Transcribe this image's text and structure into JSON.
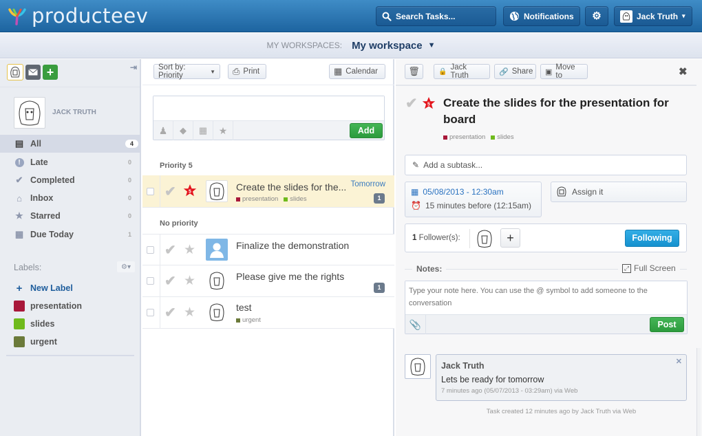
{
  "header": {
    "app_name": "producteev",
    "search_label": "Search Tasks...",
    "notifications_label": "Notifications",
    "user_label": "Jack Truth"
  },
  "workspace": {
    "label": "MY WORKSPACES:",
    "current": "My workspace"
  },
  "sidebar": {
    "profile_name": "JACK TRUTH",
    "nav": [
      {
        "label": "All",
        "count": "4",
        "icon": "all-tasks-icon"
      },
      {
        "label": "Late",
        "count": "0",
        "icon": "late-icon"
      },
      {
        "label": "Completed",
        "count": "0",
        "icon": "check-icon"
      },
      {
        "label": "Inbox",
        "count": "0",
        "icon": "inbox-icon"
      },
      {
        "label": "Starred",
        "count": "0",
        "icon": "star-icon"
      },
      {
        "label": "Due Today",
        "count": "1",
        "icon": "calendar-icon"
      }
    ],
    "labels_title": "Labels:",
    "new_label": "New Label",
    "labels": [
      {
        "name": "presentation",
        "color": "#a8183a"
      },
      {
        "name": "slides",
        "color": "#6fba1c"
      },
      {
        "name": "urgent",
        "color": "#6b7a3a"
      }
    ]
  },
  "tasklist": {
    "sort_label": "Sort by: Priority",
    "print_label": "Print",
    "calendar_label": "Calendar",
    "new_task_value": "",
    "add_label": "Add",
    "groups": [
      {
        "title": "Priority 5"
      },
      {
        "title": "No priority"
      }
    ],
    "tasks": [
      {
        "title": "Create the slides for the...",
        "due": "Tomorrow",
        "comments": "1",
        "priority": "5",
        "tags": [
          {
            "name": "presentation",
            "color": "#a8183a"
          },
          {
            "name": "slides",
            "color": "#6fba1c"
          }
        ]
      },
      {
        "title": "Finalize the demonstration",
        "due": "",
        "comments": "",
        "tags": []
      },
      {
        "title": "Please give me the rights",
        "due": "",
        "comments": "1",
        "tags": []
      },
      {
        "title": "test",
        "due": "",
        "comments": "",
        "tags": [
          {
            "name": "urgent",
            "color": "#6b7a3a"
          }
        ]
      }
    ]
  },
  "detail": {
    "owner_label": "Jack Truth",
    "share_label": "Share",
    "move_label": "Move to",
    "title": "Create the slides for the presentation for board",
    "priority": "5",
    "tags": [
      {
        "name": "presentation",
        "color": "#a8183a"
      },
      {
        "name": "slides",
        "color": "#6fba1c"
      }
    ],
    "subtask_placeholder": "Add a subtask...",
    "due_date": "05/08/2013 - 12:30am",
    "reminder": "15 minutes before (12:15am)",
    "assign_label": "Assign it",
    "followers_count": "1",
    "followers_label": "Follower(s):",
    "following_label": "Following",
    "notes_label": "Notes:",
    "fullscreen_label": "Full Screen",
    "note_placeholder": "Type your note here. You can use the @ symbol to add someone to the conversation",
    "post_label": "Post",
    "comment": {
      "author": "Jack Truth",
      "text": "Lets be ready for tomorrow",
      "meta": "7 minutes ago (05/07/2013 - 03:29am) via Web"
    },
    "created_text": "Task created 12 minutes ago by Jack Truth via Web"
  }
}
